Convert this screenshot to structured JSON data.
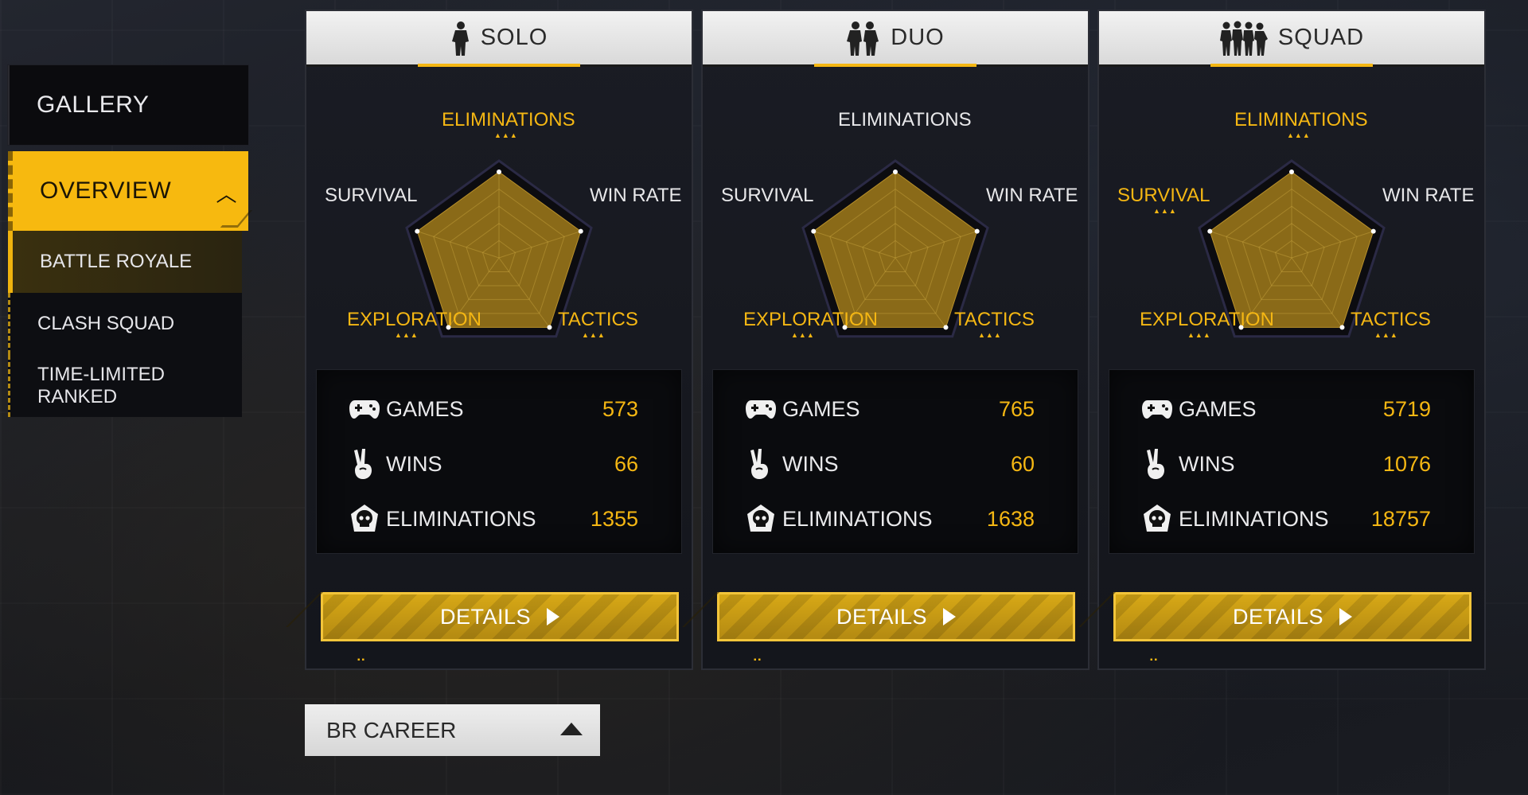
{
  "sidebar": {
    "gallery": "GALLERY",
    "overview": "OVERVIEW",
    "items": [
      "BATTLE ROYALE",
      "CLASH SQUAD",
      "TIME-LIMITED RANKED"
    ]
  },
  "radar_labels": {
    "eliminations": "ELIMINATIONS",
    "win_rate": "WIN RATE",
    "tactics": "TACTICS",
    "exploration": "EXPLORATION",
    "survival": "SURVIVAL"
  },
  "stat_labels": {
    "games": "GAMES",
    "wins": "WINS",
    "eliminations": "ELIMINATIONS"
  },
  "details_label": "DETAILS",
  "modes": [
    {
      "title": "SOLO",
      "highlights": [
        "eliminations",
        "tactics",
        "exploration"
      ],
      "radar": [
        0.94,
        0.94,
        0.94,
        0.94,
        0.94
      ],
      "games": "573",
      "wins": "66",
      "eliminations": "1355"
    },
    {
      "title": "DUO",
      "highlights": [
        "tactics",
        "exploration"
      ],
      "radar": [
        0.94,
        0.94,
        0.94,
        0.94,
        0.94
      ],
      "games": "765",
      "wins": "60",
      "eliminations": "1638"
    },
    {
      "title": "SQUAD",
      "highlights": [
        "eliminations",
        "survival",
        "tactics",
        "exploration"
      ],
      "radar": [
        0.94,
        0.94,
        0.94,
        0.94,
        0.94
      ],
      "games": "5719",
      "wins": "1076",
      "eliminations": "18757"
    }
  ],
  "br_career": "BR CAREER",
  "colors": {
    "accent": "#f5b713",
    "radar_fill": "#8a6a18",
    "panel": "#14161c"
  }
}
